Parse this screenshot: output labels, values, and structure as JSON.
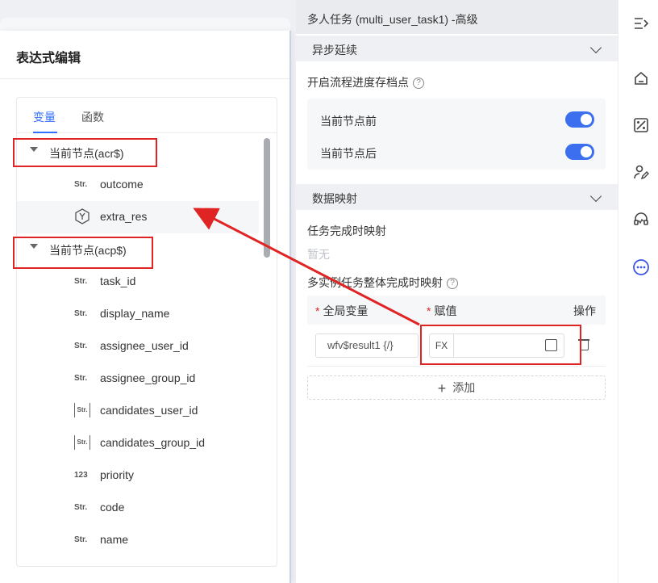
{
  "expression_editor": {
    "title": "表达式编辑",
    "tabs": [
      {
        "label": "变量",
        "active": true
      },
      {
        "label": "函数",
        "active": false
      }
    ],
    "groups": [
      {
        "label": "当前节点(acr$)",
        "items": [
          {
            "type": "Str.",
            "label": "outcome"
          },
          {
            "type": "hex-y",
            "label": "extra_res"
          }
        ]
      },
      {
        "label": "当前节点(acp$)",
        "items": [
          {
            "type": "Str.",
            "label": "task_id"
          },
          {
            "type": "Str.",
            "label": "display_name"
          },
          {
            "type": "Str.",
            "label": "assignee_user_id"
          },
          {
            "type": "Str.",
            "label": "assignee_group_id"
          },
          {
            "type": "[Str.]",
            "label": "candidates_user_id"
          },
          {
            "type": "[Str.]",
            "label": "candidates_group_id"
          },
          {
            "type": "123",
            "label": "priority"
          },
          {
            "type": "Str.",
            "label": "code"
          },
          {
            "type": "Str.",
            "label": "name"
          }
        ]
      }
    ]
  },
  "config_panel": {
    "title": "多人任务 (multi_user_task1) -高级",
    "async_section": {
      "label": "异步延续"
    },
    "checkpoint_label": "开启流程进度存档点",
    "toggles": [
      {
        "label": "当前节点前",
        "on": true
      },
      {
        "label": "当前节点后",
        "on": true
      }
    ],
    "mapping_section": {
      "label": "数据映射"
    },
    "task_complete_label": "任务完成时映射",
    "task_complete_empty": "暂无",
    "multi_instance_label": "多实例任务整体完成时映射",
    "table": {
      "col_global_var": "全局变量",
      "col_assign": "赋值",
      "col_action": "操作",
      "row": {
        "global_var_value": "wfv$result1 {/}",
        "fx_label": "FX"
      }
    },
    "add_label": "添加"
  },
  "colors": {
    "accent": "#3370ff",
    "switch": "#3b6ff0",
    "annotation": "#e02424"
  }
}
